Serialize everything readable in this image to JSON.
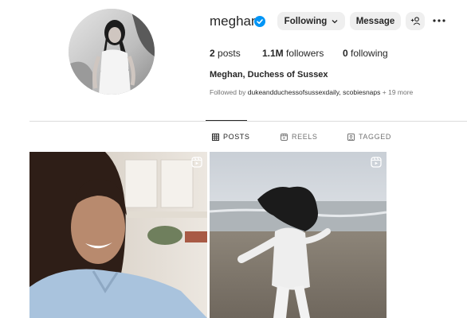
{
  "profile": {
    "username": "meghan",
    "verified": true,
    "following_label": "Following",
    "message_label": "Message",
    "stats": {
      "posts_count": "2",
      "posts_label": "posts",
      "followers_count": "1.1M",
      "followers_label": "followers",
      "following_count": "0",
      "following_label": "following"
    },
    "full_name": "Meghan, Duchess of Sussex",
    "followed_by": {
      "prefix": "Followed by",
      "accounts": "dukeandduchessofsussexdaily, scobiesnaps",
      "suffix": "+ 19 more"
    }
  },
  "tabs": [
    {
      "label": "POSTS",
      "icon": "grid-icon",
      "active": true
    },
    {
      "label": "REELS",
      "icon": "reels-icon",
      "active": false
    },
    {
      "label": "TAGGED",
      "icon": "tagged-icon",
      "active": false
    }
  ],
  "posts": [
    {
      "type": "reel",
      "icon": "reel-icon",
      "subject": "woman-smiling-portrait"
    },
    {
      "type": "reel",
      "icon": "reel-icon",
      "subject": "woman-running-on-beach"
    }
  ],
  "colors": {
    "verified_blue": "#0095f6",
    "button_bg": "#efefef",
    "text_primary": "#262626",
    "text_secondary": "#737373",
    "divider": "#dbdbdb"
  }
}
